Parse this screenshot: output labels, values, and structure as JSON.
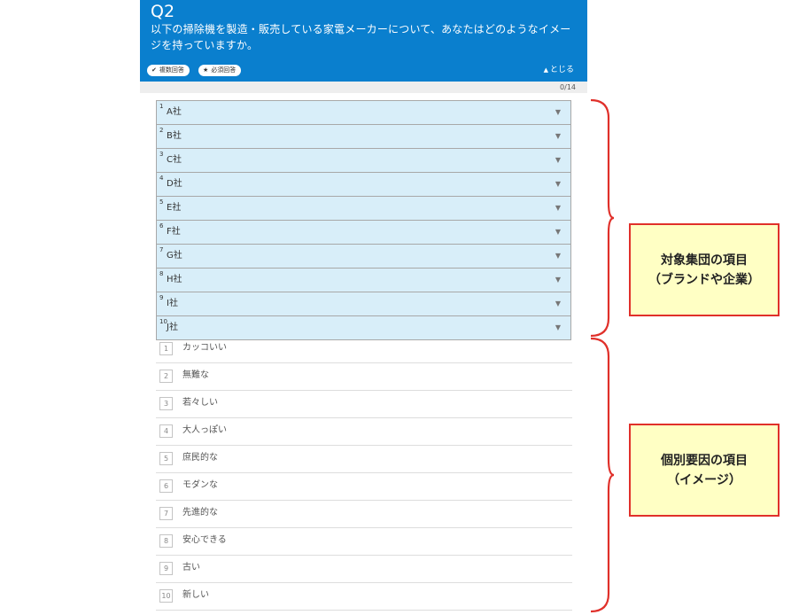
{
  "question": {
    "number": "Q2",
    "text": "以下の掃除機を製造・販売している家電メーカーについて、あなたはどのようなイメージを持っていますか。",
    "badges": {
      "multi": {
        "icon": "✔",
        "label": "複数回答"
      },
      "required": {
        "icon": "★",
        "label": "必須回答"
      }
    },
    "collapse": {
      "icon": "▲",
      "label": "とじる"
    }
  },
  "progress": {
    "text": "0/14",
    "fraction": 0
  },
  "companies": [
    {
      "num": "1",
      "name": "A社"
    },
    {
      "num": "2",
      "name": "B社"
    },
    {
      "num": "3",
      "name": "C社"
    },
    {
      "num": "4",
      "name": "D社"
    },
    {
      "num": "5",
      "name": "E社"
    },
    {
      "num": "6",
      "name": "F社"
    },
    {
      "num": "7",
      "name": "G社"
    },
    {
      "num": "8",
      "name": "H社"
    },
    {
      "num": "9",
      "name": "I社"
    },
    {
      "num": "10",
      "name": "J社"
    }
  ],
  "dropdown_arrow": "▼",
  "images": [
    {
      "num": "1",
      "label": "カッコいい"
    },
    {
      "num": "2",
      "label": "無難な"
    },
    {
      "num": "3",
      "label": "若々しい"
    },
    {
      "num": "4",
      "label": "大人っぽい"
    },
    {
      "num": "5",
      "label": "庶民的な"
    },
    {
      "num": "6",
      "label": "モダンな"
    },
    {
      "num": "7",
      "label": "先進的な"
    },
    {
      "num": "8",
      "label": "安心できる"
    },
    {
      "num": "9",
      "label": "古い"
    },
    {
      "num": "10",
      "label": "新しい"
    }
  ],
  "annotations": {
    "target": {
      "line1": "対象集団の項目",
      "line2": "（ブランドや企業）"
    },
    "factor": {
      "line1": "個別要因の項目",
      "line2": "（イメージ）"
    },
    "color": "#e0302a"
  }
}
